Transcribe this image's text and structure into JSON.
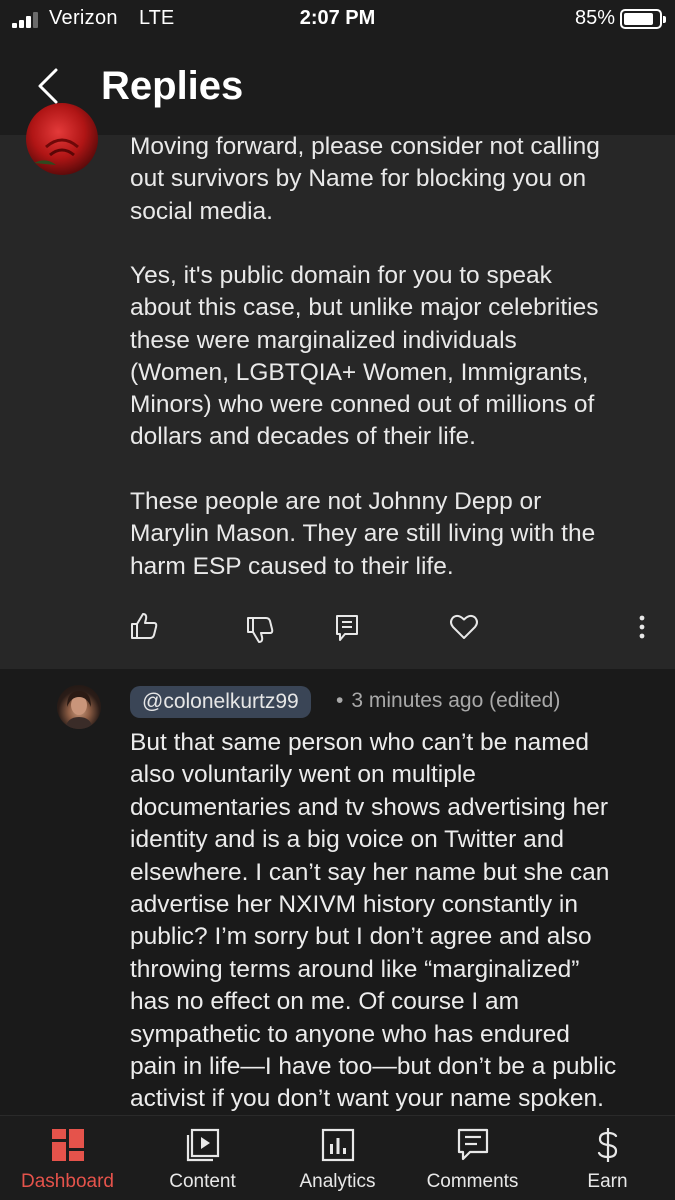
{
  "status_bar": {
    "carrier": "Verizon",
    "network": "LTE",
    "time": "2:07 PM",
    "battery_percent": "85%",
    "battery_level": 0.85
  },
  "header": {
    "back_icon": "chevron-left-icon",
    "title": "Replies"
  },
  "parent_comment": {
    "avatar": "rose-avatar",
    "paragraphs": [
      [
        "Moving forward, please consider not calling",
        "out survivors by Name for blocking you on",
        "social media."
      ],
      [
        "Yes, it's public domain for you to speak",
        "about this case, but unlike major celebrities",
        "these were marginalized individuals",
        "(Women, LGBTQIA+ Women, Immigrants,",
        "Minors) who were conned out of millions of",
        "dollars and decades of their life."
      ],
      [
        "These people are not Johnny Depp or",
        "Marylin Mason. They are still living with the",
        "harm ESP caused to their life."
      ]
    ],
    "actions": [
      "thumbs-up-icon",
      "thumbs-down-icon",
      "reply-icon",
      "heart-icon",
      "more-vert-icon"
    ]
  },
  "reply": {
    "handle": "@colonelkurtz99",
    "separator": "•",
    "meta": "3 minutes ago (edited)",
    "lines": [
      "But that same person who can’t be named",
      "also voluntarily went on multiple",
      "documentaries and tv shows advertising her",
      "identity and is a big voice on Twitter and",
      "elsewhere. I can’t say her name but she can",
      "advertise her NXIVM history constantly in",
      "public? I’m sorry but I don’t agree and also",
      "throwing terms around like “marginalized”",
      "has no effect on me. Of course I am",
      "sympathetic to anyone who has endured",
      "pain in life—I have too—but don’t be a public",
      "activist if you don’t want your name spoken."
    ]
  },
  "bottom_nav": {
    "active_color": "#e5534b",
    "items": [
      {
        "label": "Dashboard",
        "icon": "dashboard-icon",
        "active": true
      },
      {
        "label": "Content",
        "icon": "content-icon",
        "active": false
      },
      {
        "label": "Analytics",
        "icon": "analytics-icon",
        "active": false
      },
      {
        "label": "Comments",
        "icon": "comments-icon",
        "active": false
      },
      {
        "label": "Earn",
        "icon": "dollar-icon",
        "active": false
      }
    ]
  }
}
